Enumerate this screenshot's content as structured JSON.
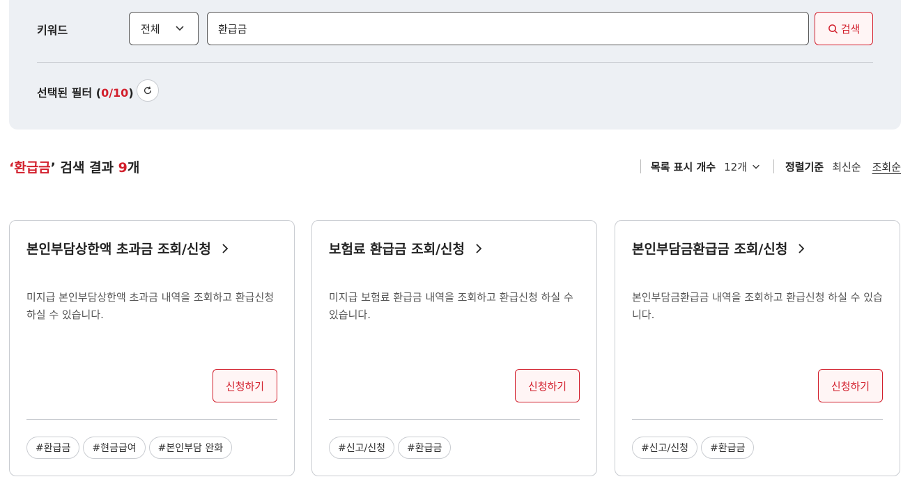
{
  "filter": {
    "keyword_label": "키워드",
    "scope": {
      "selected": "전체",
      "options": [
        "전체"
      ]
    },
    "search": {
      "value": "환급금",
      "placeholder": ""
    },
    "search_button": "검색",
    "selected_filter_label": "선택된 필터 (",
    "selected_filter_count": "0/10",
    "selected_filter_close": ")"
  },
  "results": {
    "quote_open": "‘",
    "keyword": "환급금",
    "quote_close": "’",
    "middle_text": " 검색 결과 ",
    "count": "9",
    "unit": "개"
  },
  "list_controls": {
    "page_size_label": "목록 표시 개수",
    "page_size_value": "12개",
    "sort_label": "정렬기준",
    "sort_options": [
      "최신순",
      "조회순"
    ],
    "active_sort": "조회순"
  },
  "cards": [
    {
      "title": "본인부담상한액 초과금 조회/신청",
      "description": "미지급 본인부담상한액 초과금 내역을 조회하고 환급신청 하실 수 있습니다.",
      "button": "신청하기",
      "tags": [
        "#환급금",
        "#현금급여",
        "#본인부담 완화"
      ]
    },
    {
      "title": "보험료 환급금 조회/신청",
      "description": "미지급 보험료 환급금 내역을 조회하고 환급신청 하실 수 있습니다.",
      "button": "신청하기",
      "tags": [
        "#신고/신청",
        "#환급금"
      ]
    },
    {
      "title": "본인부담금환급금 조회/신청",
      "description": "본인부담금환급금 내역을 조회하고 환급신청 하실 수 있습니다.",
      "button": "신청하기",
      "tags": [
        "#신고/신청",
        "#환급금"
      ]
    }
  ],
  "colors": {
    "accent": "#d21f2c",
    "panel_bg": "#edf0f4",
    "border": "#c9ccd1"
  }
}
